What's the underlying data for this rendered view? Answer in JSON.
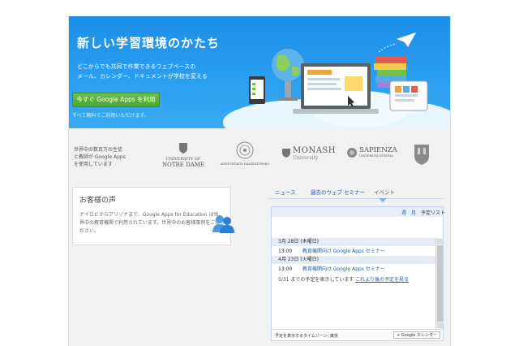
{
  "hero": {
    "title": "新しい学習環境のかたち",
    "subtitle_lines": [
      "どこからでも共同で作業できるウェブベースの",
      "メール、カレンダー、ドキュメントが学校を変える"
    ],
    "cta_label": "今すぐ Google Apps を利用",
    "cta_note": "すべて無料でご利用いただけます。"
  },
  "partners": {
    "text_lines": [
      "世界中の数百万の生徒",
      "と教師が Google Apps",
      "を使用しています"
    ],
    "universities": [
      {
        "line1": "UNIVERSITY OF",
        "line2": "NOTRE DAME"
      },
      {
        "line1": "",
        "line2": "ΑΡΙΣΤΟΤΕΛΕΙΟ ΠΑΝΕΠΙΣΤΗΜΙΟ"
      },
      {
        "line1": "MONASH",
        "line2": "University"
      },
      {
        "line1": "SAPIENZA",
        "line2": "UNIVERSITÀ DI ROMA"
      }
    ]
  },
  "testimonial": {
    "title": "お客様の声",
    "body_lines": [
      "ナイロビからアリゾナまで、Google Apps for Education は世",
      "界中の教育機関で利用されています。世界中のお客様事例をご覧く",
      "ださい。"
    ]
  },
  "tabs": [
    "ニュース",
    "過去のウェブ セミナー",
    "イベント"
  ],
  "calendar": {
    "view_buttons": [
      "週",
      "月",
      "予定リスト"
    ],
    "days": [
      {
        "label": "3月 28日 (木曜日)",
        "events": [
          {
            "time": "13:00",
            "title": "教育機関向け Google Apps セミナー"
          }
        ]
      },
      {
        "label": "4月 23日 (火曜日)",
        "events": [
          {
            "time": "13:00",
            "title": "教育機関向け Google Apps セミナー"
          }
        ]
      }
    ],
    "note": "5/31 までの予定を表示しています",
    "more_link": "これより後の予定を見る",
    "timezone": "予定を表示するタイムゾーン: 東京",
    "gcal_button": "Google カレンダー"
  },
  "colors": {
    "hero_blue": "#1c8ee8",
    "cta_green": "#4aa333",
    "link_blue": "#2a5aa6"
  }
}
